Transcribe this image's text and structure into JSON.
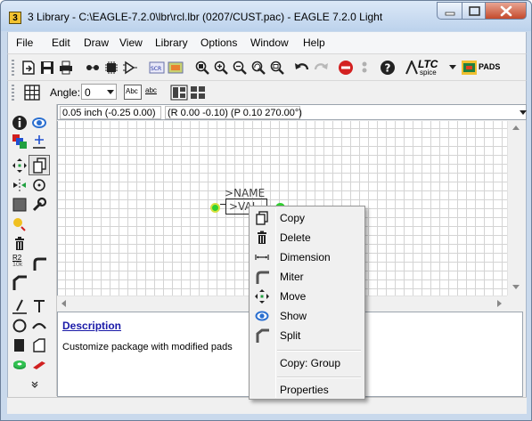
{
  "window": {
    "title": "3 Library - C:\\EAGLE-7.2.0\\lbr\\rcl.lbr (0207/CUST.pac) - EAGLE 7.2.0 Light",
    "icon_label": "3"
  },
  "menu": {
    "items": [
      "File",
      "Edit",
      "Draw",
      "View",
      "Library",
      "Options",
      "Window",
      "Help"
    ]
  },
  "toolbar": {
    "ltc_label": "LTC",
    "ltc_sub": "spice",
    "pads_label": "PADS",
    "angle_label": "Angle:",
    "angle_value": "0",
    "text_button_1": "Abc",
    "text_button_2": "abc"
  },
  "coords": {
    "position": "0.05 inch (-0.25 0.00)",
    "status": "(R 0.00 -0.10) (P 0.10 270.00°)"
  },
  "canvas": {
    "name_text": ">NAME",
    "value_text": ">VAL"
  },
  "description": {
    "title": "Description",
    "text": "Customize package with modified pads"
  },
  "left_toolbox": {
    "r2_label": "R2",
    "r2_value": "10k"
  },
  "context_menu": {
    "items": [
      {
        "label": "Copy",
        "icon": "copy-icon"
      },
      {
        "label": "Delete",
        "icon": "delete-icon"
      },
      {
        "label": "Dimension",
        "icon": "dimension-icon"
      },
      {
        "label": "Miter",
        "icon": "miter-icon"
      },
      {
        "label": "Move",
        "icon": "move-icon"
      },
      {
        "label": "Show",
        "icon": "show-icon"
      },
      {
        "label": "Split",
        "icon": "split-icon"
      }
    ],
    "group_label": "Copy: Group",
    "properties_label": "Properties"
  }
}
